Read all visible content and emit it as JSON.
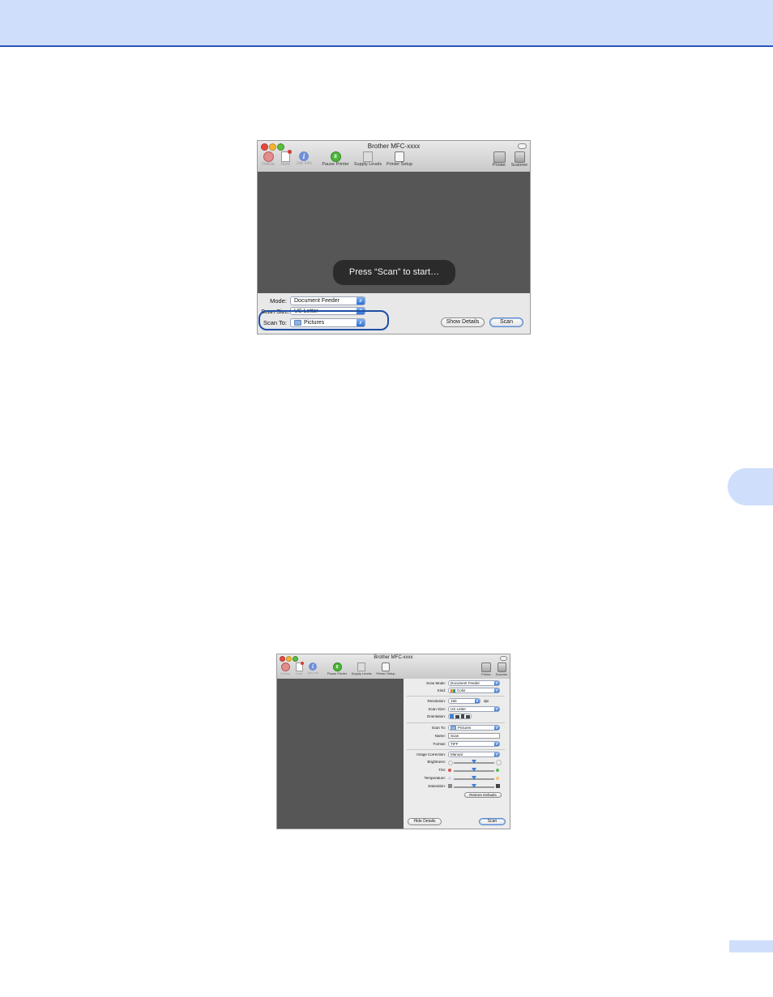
{
  "window_title": "Brother MFC-xxxx",
  "toolbar": {
    "delete": "Delete",
    "hold": "Hold",
    "job_info": "Job Info",
    "pause_printer": "Pause Printer",
    "supply_levels": "Supply Levels",
    "printer_setup": "Printer Setup",
    "printer": "Printer",
    "scanner": "Scanner"
  },
  "screenshot1": {
    "message": "Press “Scan” to start…",
    "mode_label": "Mode:",
    "mode_value": "Document Feeder",
    "scan_size_label": "Scan Size:",
    "scan_size_value": "US Letter",
    "scan_to_label": "Scan To:",
    "scan_to_value": "Pictures",
    "show_details": "Show Details",
    "scan_button": "Scan"
  },
  "screenshot2": {
    "scan_mode_label": "Scan Mode:",
    "scan_mode_value": "Document Feeder",
    "kind_label": "Kind:",
    "kind_value": "Color",
    "resolution_label": "Resolution:",
    "resolution_value": "150",
    "resolution_unit": "dpi",
    "scan_size_label": "Scan Size:",
    "scan_size_value": "US Letter",
    "orientation_label": "Orientation:",
    "scan_to_label": "Scan To:",
    "scan_to_value": "Pictures",
    "name_label": "Name:",
    "name_value": "Scan",
    "format_label": "Format:",
    "format_value": "TIFF",
    "image_correction_label": "Image Correction:",
    "image_correction_value": "Manual",
    "brightness_label": "Brightness:",
    "tint_label": "Tint:",
    "temperature_label": "Temperature:",
    "saturation_label": "Saturation:",
    "restore_defaults": "Restore Defaults",
    "hide_details": "Hide Details",
    "scan_button": "Scan"
  },
  "sliders": {
    "brightness": 0.5,
    "tint": 0.5,
    "temperature": 0.5,
    "saturation": 0.5
  }
}
